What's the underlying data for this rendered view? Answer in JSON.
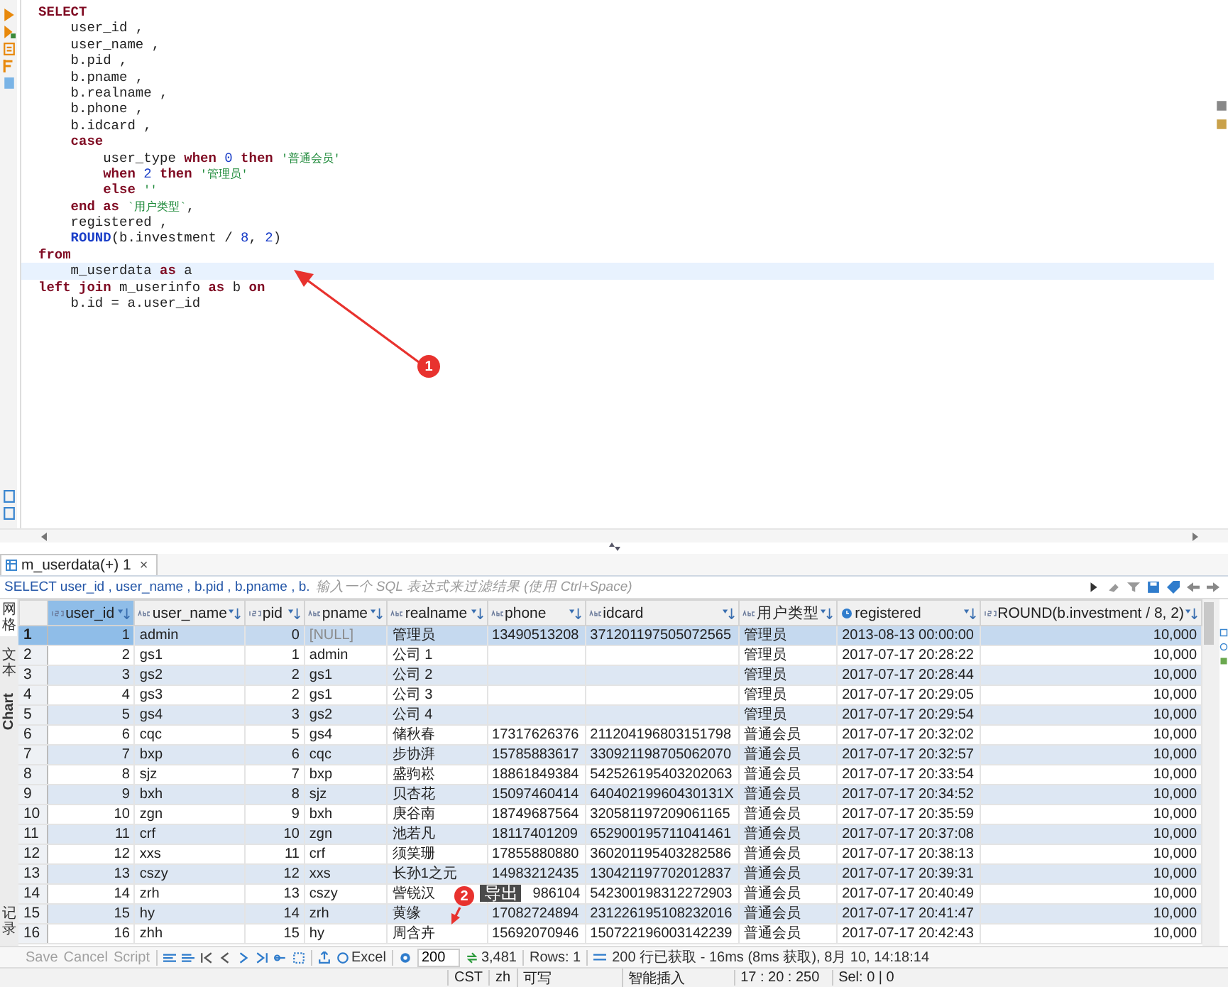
{
  "editor": {
    "lines": [
      {
        "current": false,
        "segments": [
          {
            "kind": "kw",
            "text": "SELECT"
          }
        ]
      },
      {
        "current": false,
        "segments": [
          {
            "kind": "plain",
            "text": "    user_id ,"
          }
        ]
      },
      {
        "current": false,
        "segments": [
          {
            "kind": "plain",
            "text": "    user_name ,"
          }
        ]
      },
      {
        "current": false,
        "segments": [
          {
            "kind": "plain",
            "text": "    b.pid ,"
          }
        ]
      },
      {
        "current": false,
        "segments": [
          {
            "kind": "plain",
            "text": "    b.pname ,"
          }
        ]
      },
      {
        "current": false,
        "segments": [
          {
            "kind": "plain",
            "text": "    b.realname ,"
          }
        ]
      },
      {
        "current": false,
        "segments": [
          {
            "kind": "plain",
            "text": "    b.phone ,"
          }
        ]
      },
      {
        "current": false,
        "segments": [
          {
            "kind": "plain",
            "text": "    b.idcard ,"
          }
        ]
      },
      {
        "current": false,
        "segments": [
          {
            "kind": "kw",
            "text": "    case"
          }
        ]
      },
      {
        "current": false,
        "segments": [
          {
            "kind": "plain",
            "text": "        user_type "
          },
          {
            "kind": "kw",
            "text": "when "
          },
          {
            "kind": "num",
            "text": "0 "
          },
          {
            "kind": "kw",
            "text": "then "
          },
          {
            "kind": "str",
            "text": "'普通会员'"
          }
        ]
      },
      {
        "current": false,
        "segments": [
          {
            "kind": "kw",
            "text": "        when "
          },
          {
            "kind": "num",
            "text": "2 "
          },
          {
            "kind": "kw",
            "text": "then "
          },
          {
            "kind": "str",
            "text": "'管理员'"
          }
        ]
      },
      {
        "current": false,
        "segments": [
          {
            "kind": "kw",
            "text": "        else "
          },
          {
            "kind": "str",
            "text": "''"
          }
        ]
      },
      {
        "current": false,
        "segments": [
          {
            "kind": "kw",
            "text": "    end as "
          },
          {
            "kind": "str",
            "text": "`用户类型`"
          },
          {
            "kind": "plain",
            "text": ","
          }
        ]
      },
      {
        "current": false,
        "segments": [
          {
            "kind": "plain",
            "text": "    registered ,"
          }
        ]
      },
      {
        "current": false,
        "segments": [
          {
            "kind": "fn",
            "text": "    ROUND"
          },
          {
            "kind": "plain",
            "text": "(b.investment / "
          },
          {
            "kind": "num",
            "text": "8"
          },
          {
            "kind": "plain",
            "text": ", "
          },
          {
            "kind": "num",
            "text": "2"
          },
          {
            "kind": "plain",
            "text": ")"
          }
        ]
      },
      {
        "current": false,
        "segments": [
          {
            "kind": "kw",
            "text": "from"
          }
        ]
      },
      {
        "current": true,
        "segments": [
          {
            "kind": "plain",
            "text": "    m_userdata "
          },
          {
            "kind": "kw",
            "text": "as"
          },
          {
            "kind": "plain",
            "text": " a"
          }
        ]
      },
      {
        "current": false,
        "segments": [
          {
            "kind": "kw",
            "text": "left join"
          },
          {
            "kind": "plain",
            "text": " m_userinfo "
          },
          {
            "kind": "kw",
            "text": "as "
          },
          {
            "kind": "plain",
            "text": "b "
          },
          {
            "kind": "kw",
            "text": "on"
          }
        ]
      },
      {
        "current": false,
        "segments": [
          {
            "kind": "plain",
            "text": "    b.id = a.user_id"
          }
        ]
      }
    ]
  },
  "results_tab": {
    "title": "m_userdata(+) 1",
    "close": "×"
  },
  "filter": {
    "query": "SELECT user_id , user_name , b.pid , b.pname , b.",
    "placeholder": "输入一个 SQL 表达式来过滤结果 (使用 Ctrl+Space)"
  },
  "side_tabs": [
    {
      "label": "网格",
      "kind": "cjk",
      "selected": true
    },
    {
      "label": "文本",
      "kind": "cjk",
      "selected": false
    },
    {
      "label": "Chart",
      "kind": "latin",
      "selected": false
    },
    {
      "label": "记录",
      "kind": "cjk",
      "selected": false
    }
  ],
  "table": {
    "columns": [
      {
        "label": "user_id",
        "kind": "number"
      },
      {
        "label": "user_name",
        "kind": "text"
      },
      {
        "label": "pid",
        "kind": "number"
      },
      {
        "label": "pname",
        "kind": "text"
      },
      {
        "label": "realname",
        "kind": "text"
      },
      {
        "label": "phone",
        "kind": "text"
      },
      {
        "label": "idcard",
        "kind": "text"
      },
      {
        "label": "用户类型",
        "kind": "text"
      },
      {
        "label": "registered",
        "kind": "date"
      },
      {
        "label": "ROUND(b.investment / 8, 2)",
        "kind": "number"
      }
    ],
    "rows": [
      {
        "number": "1",
        "selected": true,
        "cells": [
          "1",
          "admin",
          "0",
          {
            "text": "[NULL]",
            "null": true
          },
          "管理员",
          "13490513208",
          "371201197505072565",
          "管理员",
          "2013-08-13 00:00:00",
          "10,000"
        ]
      },
      {
        "number": "2",
        "selected": false,
        "cells": [
          "2",
          "gs1",
          "1",
          "admin",
          "公司 1",
          null,
          null,
          "管理员",
          "2017-07-17 20:28:22",
          "10,000"
        ]
      },
      {
        "number": "3",
        "selected": false,
        "cells": [
          "3",
          "gs2",
          "2",
          "gs1",
          "公司 2",
          null,
          null,
          "管理员",
          "2017-07-17 20:28:44",
          "10,000"
        ]
      },
      {
        "number": "4",
        "selected": false,
        "cells": [
          "4",
          "gs3",
          "2",
          "gs1",
          "公司 3",
          null,
          null,
          "管理员",
          "2017-07-17 20:29:05",
          "10,000"
        ]
      },
      {
        "number": "5",
        "selected": false,
        "cells": [
          "5",
          "gs4",
          "3",
          "gs2",
          "公司 4",
          null,
          null,
          "管理员",
          "2017-07-17 20:29:54",
          "10,000"
        ]
      },
      {
        "number": "6",
        "selected": false,
        "cells": [
          "6",
          "cqc",
          "5",
          "gs4",
          "储秋春",
          "17317626376",
          "211204196803151798",
          "普通会员",
          "2017-07-17 20:32:02",
          "10,000"
        ]
      },
      {
        "number": "7",
        "selected": false,
        "cells": [
          "7",
          "bxp",
          "6",
          "cqc",
          "步协湃",
          "15785883617",
          "330921198705062070",
          "普通会员",
          "2017-07-17 20:32:57",
          "10,000"
        ]
      },
      {
        "number": "8",
        "selected": false,
        "cells": [
          "8",
          "sjz",
          "7",
          "bxp",
          "盛驹崧",
          "18861849384",
          "542526195403202063",
          "普通会员",
          "2017-07-17 20:33:54",
          "10,000"
        ]
      },
      {
        "number": "9",
        "selected": false,
        "cells": [
          "9",
          "bxh",
          "8",
          "sjz",
          "贝杏花",
          "15097460414",
          "64040219960430131X",
          "普通会员",
          "2017-07-17 20:34:52",
          "10,000"
        ]
      },
      {
        "number": "10",
        "selected": false,
        "cells": [
          "10",
          "zgn",
          "9",
          "bxh",
          "庚谷南",
          "18749687564",
          "320581197209061165",
          "普通会员",
          "2017-07-17 20:35:59",
          "10,000"
        ]
      },
      {
        "number": "11",
        "selected": false,
        "cells": [
          "11",
          "crf",
          "10",
          "zgn",
          "池若凡",
          "18117401209",
          "652900195711041461",
          "普通会员",
          "2017-07-17 20:37:08",
          "10,000"
        ]
      },
      {
        "number": "12",
        "selected": false,
        "cells": [
          "12",
          "xxs",
          "11",
          "crf",
          "须笑珊",
          "17855880880",
          "360201195403282586",
          "普通会员",
          "2017-07-17 20:38:13",
          "10,000"
        ]
      },
      {
        "number": "13",
        "selected": false,
        "cells": [
          "13",
          "cszy",
          "12",
          "xxs",
          "长孙1之元",
          "14983212435",
          "130421197702012837",
          "普通会员",
          "2017-07-17 20:39:31",
          "10,000"
        ]
      },
      {
        "number": "14",
        "selected": false,
        "cells": [
          "14",
          "zrh",
          "13",
          "cszy",
          "訾锐汉",
          {
            "text": "986104",
            "covered": true
          },
          "542300198312272903",
          "普通会员",
          "2017-07-17 20:40:49",
          "10,000"
        ]
      },
      {
        "number": "15",
        "selected": false,
        "cells": [
          "15",
          "hy",
          "14",
          "zrh",
          "黄缘",
          "17082724894",
          "231226195108232016",
          "普通会员",
          "2017-07-17 20:41:47",
          "10,000"
        ]
      },
      {
        "number": "16",
        "selected": false,
        "cells": [
          "16",
          "zhh",
          "15",
          "hy",
          "周含卉",
          "15692070946",
          "150722196003142239",
          "普通会员",
          "2017-07-17 20:42:43",
          "10,000"
        ]
      }
    ]
  },
  "toolbar": {
    "buttons": [
      {
        "label": "Save",
        "disabled": true
      },
      {
        "label": "Cancel",
        "disabled": true
      },
      {
        "label": "Script",
        "disabled": true
      }
    ],
    "export": "Excel",
    "fetch_size": "200",
    "total": "3,481",
    "rows": "Rows: 1",
    "message": "200 行已获取 - 16ms (8ms 获取), 8月 10, 14:18:14"
  },
  "status_bar": [
    "CST",
    "zh",
    "可写",
    "智能插入",
    "17 : 20 : 250",
    "Sel: 0 | 0"
  ],
  "annotations": {
    "markers": [
      "1",
      "2"
    ],
    "tooltip": "导出"
  }
}
